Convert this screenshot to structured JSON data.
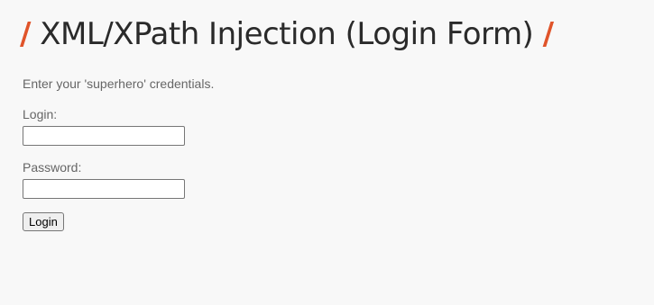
{
  "page": {
    "title_prefix": "/",
    "title": "XML/XPath Injection (Login Form)",
    "title_suffix": "/",
    "intro": "Enter your 'superhero' credentials."
  },
  "form": {
    "login_label": "Login:",
    "login_value": "",
    "password_label": "Password:",
    "password_value": "",
    "submit_label": "Login"
  },
  "colors": {
    "accent": "#e0542a",
    "heading": "#2a2a2a",
    "text": "#666666",
    "background": "#f8f8f8"
  }
}
